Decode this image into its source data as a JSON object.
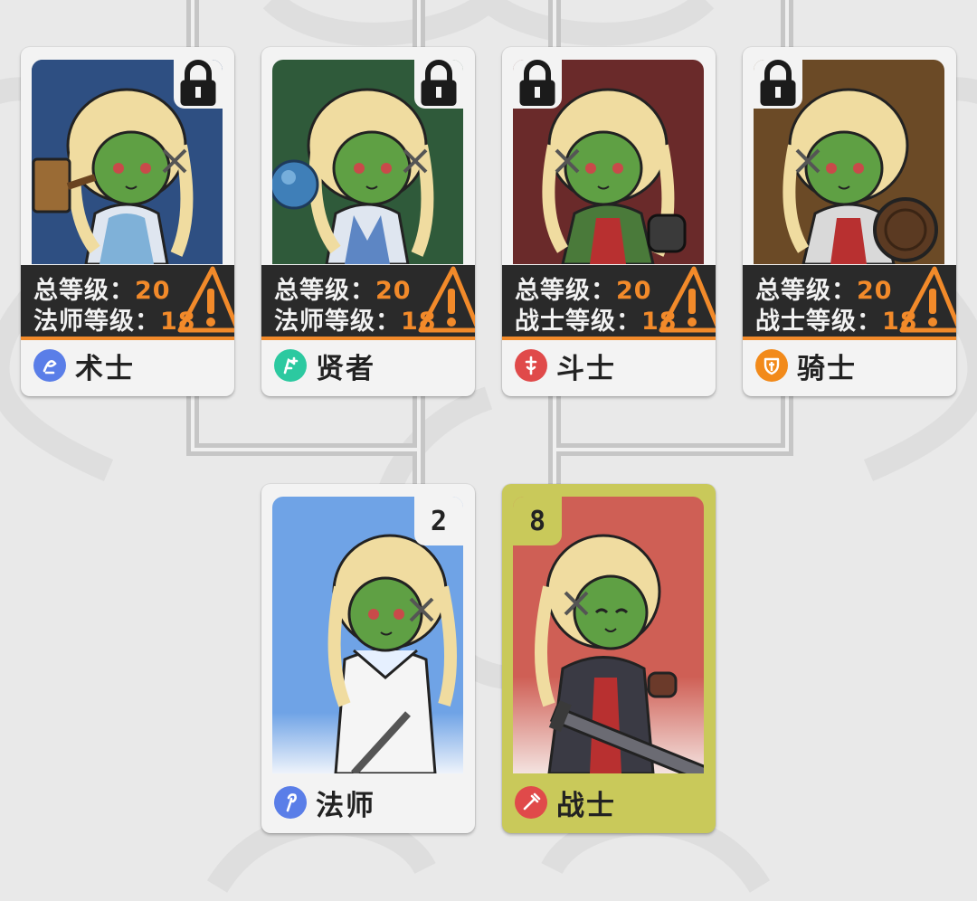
{
  "requirement_labels": {
    "total_level": "总等级：",
    "mage_level": "法师等级：",
    "warrior_level": "战士等级："
  },
  "advanced_classes": [
    {
      "name": "术士",
      "total_level": "20",
      "class_level": "18",
      "portrait_color": "#2e4f82",
      "icon_color": "#5a7ee8",
      "locked": true
    },
    {
      "name": "贤者",
      "total_level": "20",
      "class_level": "18",
      "portrait_color": "#2f5a3a",
      "icon_color": "#2cc9a0",
      "locked": true
    },
    {
      "name": "斗士",
      "total_level": "20",
      "class_level": "18",
      "portrait_color": "#6a2a2a",
      "icon_color": "#e04a4a",
      "locked": true
    },
    {
      "name": "骑士",
      "total_level": "20",
      "class_level": "18",
      "portrait_color": "#6b4a26",
      "icon_color": "#f28a1a",
      "locked": true
    }
  ],
  "base_classes": [
    {
      "name": "法师",
      "count": "2",
      "portrait_color": "#6fa3e6",
      "icon_color": "#5a7ee8",
      "selected": false
    },
    {
      "name": "战士",
      "count": "8",
      "portrait_color": "#cf5f55",
      "icon_color": "#e04a4a",
      "selected": true
    }
  ],
  "colors": {
    "accent_orange": "#f28a2a",
    "selected_highlight": "#c9c95a",
    "connector": "#c9c9c9"
  }
}
